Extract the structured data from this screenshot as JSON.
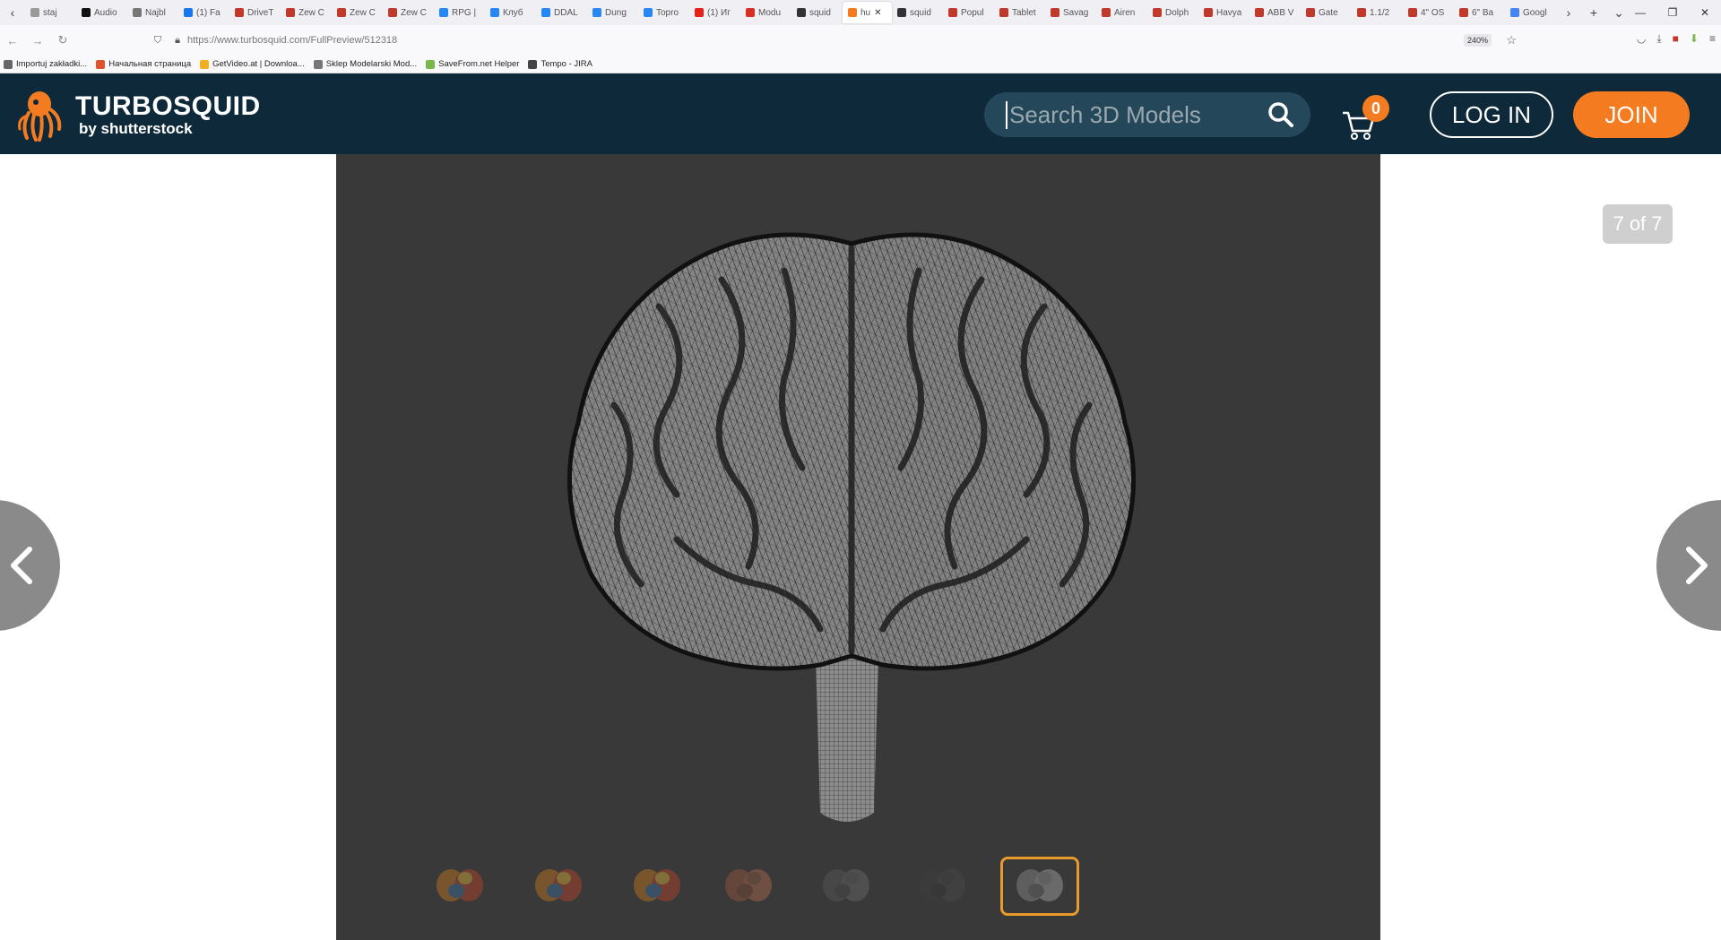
{
  "browser": {
    "tabs": [
      {
        "label": "staj",
        "icon": "generic-tab-icon",
        "color": "#9a9a9a"
      },
      {
        "label": "Audio",
        "icon": "b-icon",
        "color": "#111111"
      },
      {
        "label": "Najbl",
        "icon": "generic-tab-icon",
        "color": "#777777"
      },
      {
        "label": "(1) Fa",
        "icon": "facebook-icon",
        "color": "#1877f2"
      },
      {
        "label": "DriveT",
        "icon": "drive-icon",
        "color": "#c0392b"
      },
      {
        "label": "Zew C",
        "icon": "zew-icon",
        "color": "#c0392b"
      },
      {
        "label": "Zew C",
        "icon": "zew-icon",
        "color": "#c0392b"
      },
      {
        "label": "Zew C",
        "icon": "zew-icon",
        "color": "#c0392b"
      },
      {
        "label": "RPG |",
        "icon": "vk-icon",
        "color": "#2787f5"
      },
      {
        "label": "Клуб",
        "icon": "vk-icon",
        "color": "#2787f5"
      },
      {
        "label": "DDAL",
        "icon": "vk-icon",
        "color": "#2787f5"
      },
      {
        "label": "Dung",
        "icon": "vk-icon",
        "color": "#2787f5"
      },
      {
        "label": "Topro",
        "icon": "vk-icon",
        "color": "#2787f5"
      },
      {
        "label": "(1) Иг",
        "icon": "youtube-icon",
        "color": "#e62117"
      },
      {
        "label": "Modu",
        "icon": "gmail-icon",
        "color": "#d93025"
      },
      {
        "label": "squid",
        "icon": "squid-icon",
        "color": "#333333"
      },
      {
        "label": "hu",
        "icon": "turbosquid-icon",
        "color": "#f47b20"
      },
      {
        "label": "squid",
        "icon": "squid-icon",
        "color": "#333333"
      },
      {
        "label": "Popul",
        "icon": "gc-icon",
        "color": "#c0392b"
      },
      {
        "label": "Tablet",
        "icon": "gc-icon",
        "color": "#c0392b"
      },
      {
        "label": "Savag",
        "icon": "gc-icon",
        "color": "#c0392b"
      },
      {
        "label": "Airen",
        "icon": "gc-icon",
        "color": "#c0392b"
      },
      {
        "label": "Dolph",
        "icon": "gc-icon",
        "color": "#c0392b"
      },
      {
        "label": "Havya",
        "icon": "gc-icon",
        "color": "#c0392b"
      },
      {
        "label": "ABB V",
        "icon": "gc-icon",
        "color": "#c0392b"
      },
      {
        "label": "Gate",
        "icon": "gc-icon",
        "color": "#c0392b"
      },
      {
        "label": "1.1/2",
        "icon": "gc-icon",
        "color": "#c0392b"
      },
      {
        "label": "4\" OS",
        "icon": "gc-icon",
        "color": "#c0392b"
      },
      {
        "label": "6\" Ba",
        "icon": "gc-icon",
        "color": "#c0392b"
      },
      {
        "label": "Googl",
        "icon": "google-translate-icon",
        "color": "#4285f4"
      }
    ],
    "active_tab_index": 16,
    "url": "https://www.turbosquid.com/FullPreview/512318",
    "zoom": "240%",
    "bookmarks": [
      {
        "label": "Importuj zakładki...",
        "color": "#666666"
      },
      {
        "label": "Начальная страница",
        "color": "#e2522f"
      },
      {
        "label": "GetVideo.at | Downloa...",
        "color": "#f2b01e"
      },
      {
        "label": "Sklep Modelarski Mod...",
        "color": "#777777"
      },
      {
        "label": "SaveFrom.net Helper",
        "color": "#7ab648"
      },
      {
        "label": "Tempo - JIRA",
        "color": "#444444"
      }
    ]
  },
  "site": {
    "logo_brand": "TURBOSQUID",
    "logo_sub": "by shutterstock",
    "search_placeholder": "Search 3D Models",
    "cart_count": "0",
    "login_label": "LOG IN",
    "join_label": "JOIN",
    "brand_color": "#0e2a3a",
    "accent_color": "#f47b20"
  },
  "viewer": {
    "counter": "7 of 7",
    "thumbnails": [
      {
        "name": "brain-thumb-1",
        "style": "color"
      },
      {
        "name": "brain-thumb-2",
        "style": "color"
      },
      {
        "name": "brain-thumb-3",
        "style": "color"
      },
      {
        "name": "brain-thumb-4",
        "style": "red"
      },
      {
        "name": "brain-thumb-5",
        "style": "wire-light"
      },
      {
        "name": "brain-thumb-6",
        "style": "wire-dark"
      },
      {
        "name": "brain-thumb-7",
        "style": "wire",
        "selected": true
      }
    ]
  }
}
